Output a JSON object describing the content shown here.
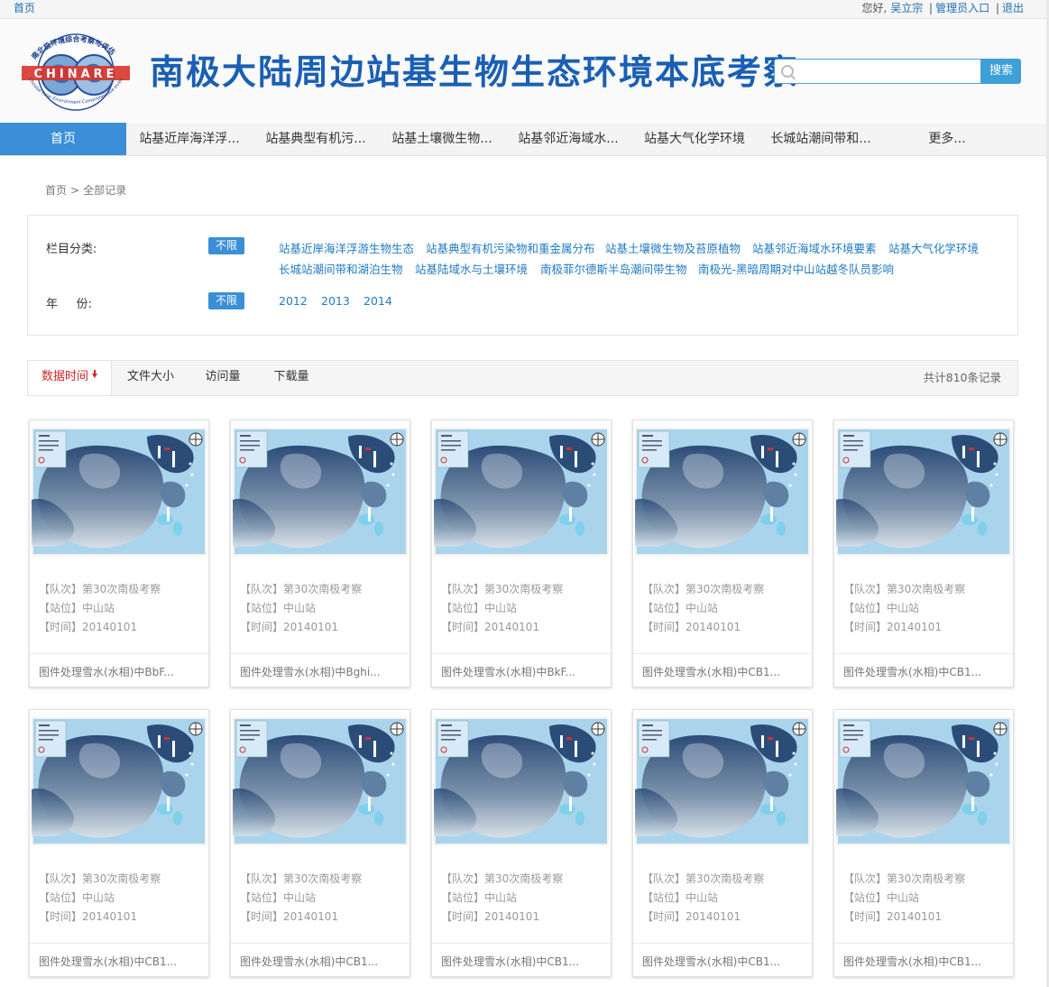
{
  "topbar": {
    "home": "首页",
    "greeting": "您好,",
    "user": "吴立宗",
    "admin": "管理员入口",
    "logout": "退出",
    "separator": "|"
  },
  "header": {
    "title": "南极大陆周边站基生物生态环境本底考察",
    "logo_text": "CHINARE",
    "logo_caption_top": "南北极环境综合考察与评估",
    "logo_caption_bottom": "Chinese Polar Environment Comprehensive Investigation & Assessment Programmes"
  },
  "search": {
    "placeholder": "",
    "button": "搜索"
  },
  "nav": {
    "items": [
      "首页",
      "站基近岸海洋浮...",
      "站基典型有机污...",
      "站基土壤微生物...",
      "站基邻近海域水...",
      "站基大气化学环境",
      "长城站潮间带和...",
      "更多..."
    ]
  },
  "breadcrumb": {
    "home": "首页",
    "sep": ">",
    "current": "全部记录"
  },
  "filter": {
    "category_label": "栏目分类:",
    "year_label": "年     份:",
    "unlimited": "不限",
    "categories": [
      "站基近岸海洋浮游生物生态",
      "站基典型有机污染物和重金属分布",
      "站基土壤微生物及苔原植物",
      "站基邻近海域水环境要素",
      "站基大气化学环境",
      "长城站潮间带和湖泊生物",
      "站基陆域水与土壤环境",
      "南极菲尔德斯半岛潮间带生物",
      "南极光-黑暗周期对中山站越冬队员影响"
    ],
    "years": [
      "2012",
      "2013",
      "2014"
    ]
  },
  "sort": {
    "items": [
      "数据时间",
      "文件大小",
      "访问量",
      "下载量"
    ],
    "total": "共计810条记录"
  },
  "cards": [
    {
      "team": "【队次】第30次南极考察",
      "station": "【站位】中山站",
      "time": "【时间】20140101",
      "title": "图件处理雪水(水相)中BbF..."
    },
    {
      "team": "【队次】第30次南极考察",
      "station": "【站位】中山站",
      "time": "【时间】20140101",
      "title": "图件处理雪水(水相)中Bghi..."
    },
    {
      "team": "【队次】第30次南极考察",
      "station": "【站位】中山站",
      "time": "【时间】20140101",
      "title": "图件处理雪水(水相)中BkF..."
    },
    {
      "team": "【队次】第30次南极考察",
      "station": "【站位】中山站",
      "time": "【时间】20140101",
      "title": "图件处理雪水(水相)中CB1..."
    },
    {
      "team": "【队次】第30次南极考察",
      "station": "【站位】中山站",
      "time": "【时间】20140101",
      "title": "图件处理雪水(水相)中CB1..."
    },
    {
      "team": "【队次】第30次南极考察",
      "station": "【站位】中山站",
      "time": "【时间】20140101",
      "title": "图件处理雪水(水相)中CB1..."
    },
    {
      "team": "【队次】第30次南极考察",
      "station": "【站位】中山站",
      "time": "【时间】20140101",
      "title": "图件处理雪水(水相)中CB1..."
    },
    {
      "team": "【队次】第30次南极考察",
      "station": "【站位】中山站",
      "time": "【时间】20140101",
      "title": "图件处理雪水(水相)中CB1..."
    },
    {
      "team": "【队次】第30次南极考察",
      "station": "【站位】中山站",
      "time": "【时间】20140101",
      "title": "图件处理雪水(水相)中CB1..."
    },
    {
      "team": "【队次】第30次南极考察",
      "station": "【站位】中山站",
      "time": "【时间】20140101",
      "title": "图件处理雪水(水相)中CB1..."
    }
  ],
  "colors": {
    "accent": "#3a8fd6",
    "title_blue": "#1a5fb4",
    "link_blue": "#1f7ac0",
    "sort_active_red": "#d0242a"
  }
}
